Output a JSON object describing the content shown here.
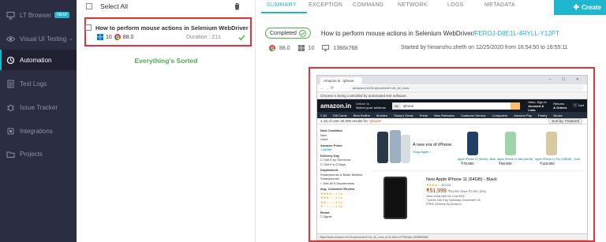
{
  "sidebar": {
    "items": [
      {
        "label": "LT Browser",
        "badge": "NEW",
        "icon": "monitor-icon"
      },
      {
        "label": "Visual UI Testing",
        "chevron": "⌄",
        "icon": "eye-icon"
      },
      {
        "label": "Automation",
        "icon": "automation-icon"
      },
      {
        "label": "Test Logs",
        "icon": "document-icon"
      },
      {
        "label": "Issue Tracker",
        "icon": "bug-icon"
      },
      {
        "label": "Integrations",
        "icon": "plug-icon"
      },
      {
        "label": "Projects",
        "icon": "folder-icon"
      }
    ]
  },
  "list": {
    "select_all_label": "Select All",
    "test": {
      "title": "How to perform mouse actions in Selenium WebDriver",
      "os_version": "10",
      "browser_version": "88.0",
      "duration": "Duration : 21s"
    },
    "empty_message": "Everything's Sorted"
  },
  "tabs": [
    {
      "label": "SUMMARY",
      "active": true
    },
    {
      "label": "EXCEPTION"
    },
    {
      "label": "COMMAND"
    },
    {
      "label": "NETWORK"
    },
    {
      "label": "LOGS"
    },
    {
      "label": "METADATA"
    }
  ],
  "create_button": {
    "label": "Create"
  },
  "detail": {
    "status": "Completed",
    "test_name": "How to perform mouse actions in Selenium WebDriver/",
    "test_id": "FEROJ-D8E1L-4RYLL-Y12PT",
    "browser_version": "88.0",
    "os_version": "10",
    "resolution": "1366x768",
    "started": "Started by himanshu.sheth on 12/25/2020 from 16:54:50 to 16:55:11"
  },
  "screenshot": {
    "tab_title": "Amazon.in : iphone",
    "url": "amazon.in/s?k=iphone&ref=nb_sb_noss",
    "warning": "Chrome is being controlled by automated test software.",
    "logo": "amazon.in",
    "deliver_line1": "Deliver to",
    "deliver_line2": "Select your address",
    "search_category": "All",
    "search_query": "iphone",
    "account_line1": "Hello, Sign in",
    "account_line2": "Account & Lists",
    "returns_line1": "Returns",
    "returns_line2": "& Orders",
    "cart_label": "Cart",
    "nav_items": [
      "≡ All",
      "Gift Cards",
      "Best Sellers",
      "Mobiles",
      "Today's Deals",
      "Prime",
      "New Releases",
      "Customer Service",
      "Computers",
      "Amazon Pay",
      "Pantry",
      "Books"
    ],
    "results_text": "1-16 of over 40,000 results for",
    "results_query": "\"iphone\"",
    "sort_label": "Sort by: Featured",
    "filters": [
      {
        "text": "New Condition",
        "head": true
      },
      {
        "text": "New"
      },
      {
        "text": "Used"
      },
      {
        "text": "Amazon Prime",
        "head": true
      },
      {
        "text": "✓prime",
        "prime": true
      },
      {
        "text": "Delivery Day",
        "head": true
      },
      {
        "text": "☐ Get It by Tomorrow"
      },
      {
        "text": "☐ Get It in 2 Days"
      },
      {
        "text": "Department",
        "head": true
      },
      {
        "text": "Smartphones & Basic Mobiles"
      },
      {
        "text": "  Smartphones"
      },
      {
        "text": "< See All 5 Departments"
      },
      {
        "text": "Avg. Customer Review",
        "head": true
      },
      {
        "text": "★★★★☆ & Up",
        "stars": true
      },
      {
        "text": "★★★☆☆ & Up",
        "stars": true
      },
      {
        "text": "★★☆☆☆ & Up",
        "stars": true
      },
      {
        "text": "★☆☆☆☆ & Up",
        "stars": true
      },
      {
        "text": "Brand",
        "head": true
      },
      {
        "text": "☐ Apple"
      }
    ],
    "banner_tag": "A new era of iPhone.",
    "banner_shop": "Shop Apple ›",
    "banner_prices": [
      "₹79,900",
      "₹69,900",
      "₹119,900"
    ],
    "banner_names": [
      "Apple iPhone 12 (64GB) - Blue",
      "Apple iPhone 12 Mini (64GB)",
      "Apple iPhone 12 Pro (128GB) - Gold"
    ],
    "product_title": "New Apple iPhone 11 (64GB) - Black",
    "product_rating": "★★★★☆",
    "product_rating_count": "15,010",
    "product_price": "₹51,999",
    "product_mrp": "₹54,900  Save ₹2,901 (5%)",
    "product_lines": [
      "Save extra with No Cost EMI",
      "✓prime Get it by Saturday, December 26",
      "FREE Delivery by Amazon"
    ],
    "status_url": "https://www.amazon.in/s?k=iphone&ref=nb_sb_noss_sr=8-1&ie=UTF8&qid=1608899686"
  },
  "colors": {
    "accent": "#1fb6cf",
    "sidebar_bg": "#2b2d42",
    "highlight_red": "#e0343a",
    "success_green": "#4caf50"
  }
}
